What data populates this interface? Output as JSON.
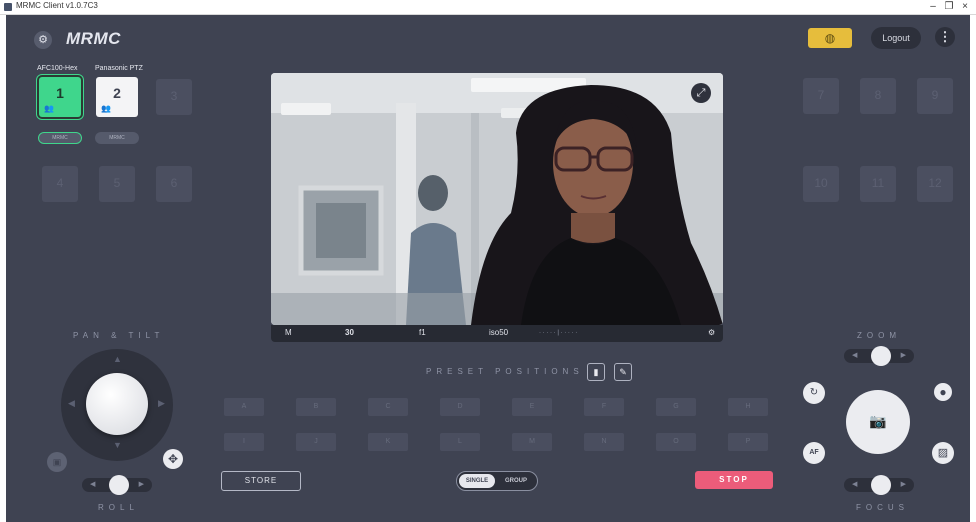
{
  "window": {
    "title": "MRMC Client v1.0.7C3",
    "controls": [
      "–",
      "❐",
      "×"
    ]
  },
  "header": {
    "brand": "MRMC",
    "logout_label": "Logout",
    "kebab_glyph": "⋮",
    "globe_glyph": "◍",
    "gear_glyph": "⚙"
  },
  "cameras": {
    "names": [
      "AFC100-Hex",
      "Panasonic PTZ"
    ],
    "numbers": [
      "1",
      "2",
      "3",
      "4",
      "5",
      "6",
      "7",
      "8",
      "9",
      "10",
      "11",
      "12"
    ],
    "pill_labels": [
      "MRMC",
      "MRMC"
    ],
    "active_color": "#3fd68c",
    "person_glyph": "👥"
  },
  "video": {
    "mode": "M",
    "shutter": "30",
    "iris": "f1",
    "iso": "iso50",
    "scale": "· · · · · | · · · · ·",
    "expand_glyph": "⤢",
    "settings_glyph": "⚙"
  },
  "presets": {
    "title": "PRESET POSITIONS",
    "row1": [
      "A",
      "B",
      "C",
      "D",
      "E",
      "F",
      "G",
      "H"
    ],
    "row2": [
      "I",
      "J",
      "K",
      "L",
      "M",
      "N",
      "O",
      "P"
    ],
    "store_label": "STORE",
    "single_label": "SINGLE",
    "group_label": "GROUP",
    "stop_label": "STOP",
    "stop_color": "#ec5c7a",
    "delete_glyph": "▮",
    "edit_glyph": "✎"
  },
  "pan_tilt": {
    "title": "PAN & TILT",
    "roll_title": "ROLL"
  },
  "zoom": {
    "title": "ZOOM",
    "focus_title": "FOCUS",
    "af_label": "AF",
    "camera_glyph": "📷"
  }
}
